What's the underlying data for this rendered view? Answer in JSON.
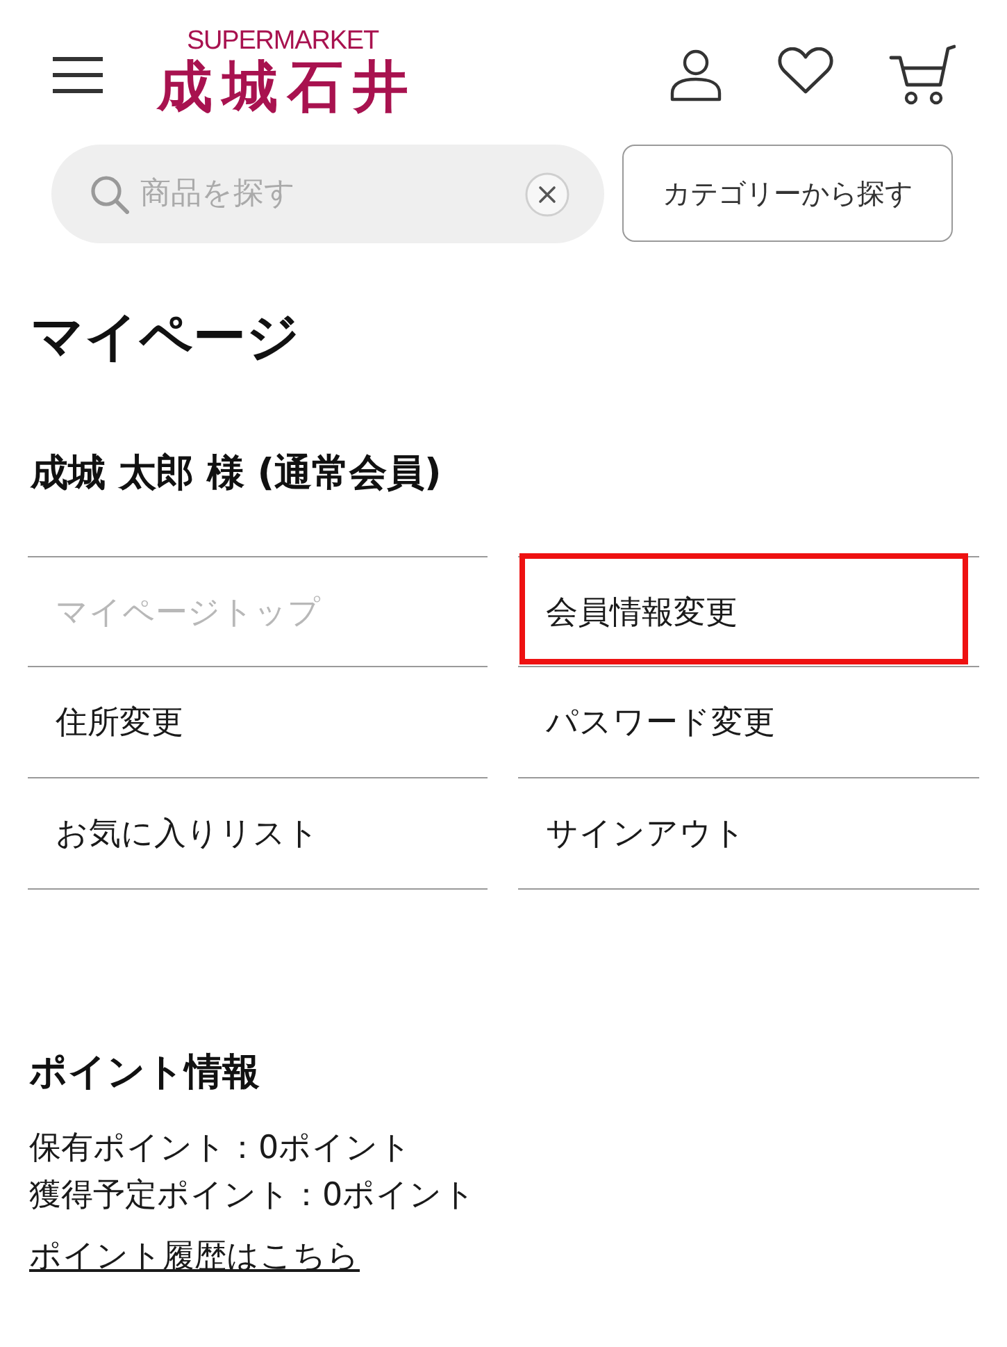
{
  "header": {
    "logo": {
      "tagline": "SUPERMARKET",
      "name": "成城石井"
    }
  },
  "search": {
    "placeholder": "商品を探す"
  },
  "category_button": "カテゴリーから探す",
  "page_title": "マイページ",
  "member_name": "成城 太郎 様 (通常会員)",
  "menu": [
    {
      "label": "マイページトップ",
      "disabled": true,
      "highlighted": false
    },
    {
      "label": "会員情報変更",
      "disabled": false,
      "highlighted": true
    },
    {
      "label": "住所変更",
      "disabled": false,
      "highlighted": false
    },
    {
      "label": "パスワード変更",
      "disabled": false,
      "highlighted": false
    },
    {
      "label": "お気に入りリスト",
      "disabled": false,
      "highlighted": false
    },
    {
      "label": "サインアウト",
      "disabled": false,
      "highlighted": false
    }
  ],
  "points": {
    "title": "ポイント情報",
    "lines": [
      "保有ポイント：0ポイント",
      "獲得予定ポイント：0ポイント"
    ],
    "link": "ポイント履歴はこちら"
  }
}
